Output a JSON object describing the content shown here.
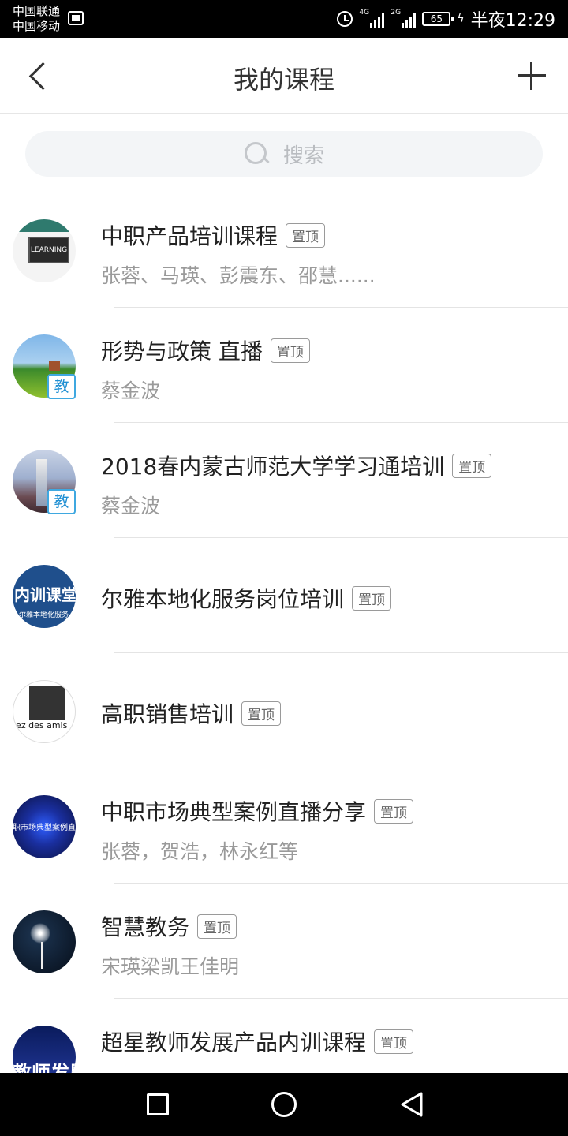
{
  "status_bar": {
    "carrier_1": "中国联通",
    "carrier_2": "中国移动",
    "net_1": "4G",
    "net_2": "2G",
    "battery": "65",
    "time": "半夜12:29"
  },
  "header": {
    "title": "我的课程",
    "back_icon": "chevron-left-icon",
    "add_icon": "plus-icon"
  },
  "search": {
    "placeholder": "搜索"
  },
  "courses": [
    {
      "title": "中职产品培训课程",
      "badge": "置顶",
      "members": "张蓉、马瑛、彭震东、邵慧......",
      "teach_badge": ""
    },
    {
      "title": "形势与政策 直播",
      "badge": "置顶",
      "members": "蔡金波",
      "teach_badge": "教"
    },
    {
      "title": "2018春内蒙古师范大学学习通培训",
      "badge": "置顶",
      "members": "蔡金波",
      "teach_badge": "教"
    },
    {
      "title": "尔雅本地化服务岗位培训",
      "badge": "置顶",
      "members": "",
      "teach_badge": ""
    },
    {
      "title": "高职销售培训",
      "badge": "置顶",
      "members": "",
      "teach_badge": ""
    },
    {
      "title": "中职市场典型案例直播分享",
      "badge": "置顶",
      "members": "张蓉，贺浩，林永红等",
      "teach_badge": ""
    },
    {
      "title": "智慧教务",
      "badge": "置顶",
      "members": "宋瑛梁凯王佳明",
      "teach_badge": ""
    },
    {
      "title": "超星教师发展产品内训课程",
      "badge": "置顶",
      "members": "",
      "teach_badge": ""
    }
  ],
  "avatar_text": {
    "a1": "LEARNING",
    "a4_big": "内训课堂",
    "a4_small": "尔雅本地化服务",
    "a5": "lez des amis",
    "a6": "职市场典型案例直",
    "a8": "教师发展"
  }
}
